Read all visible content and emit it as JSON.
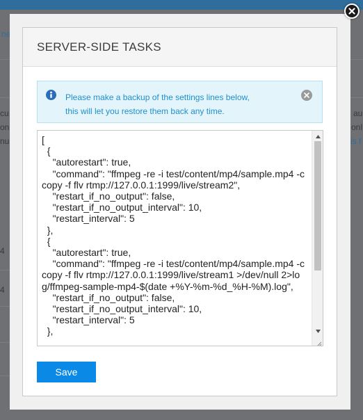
{
  "modal": {
    "title": "SERVER-SIDE TASKS"
  },
  "alert": {
    "line1": "Please make a backup of the settings lines below,",
    "line2": "this will let you restore them back any time."
  },
  "editor": {
    "content": "[\n  {\n    \"autorestart\": true,\n    \"command\": \"ffmpeg -re -i test/content/mp4/sample.mp4 -c copy -f flv rtmp://127.0.0.1:1999/live/stream2\",\n    \"restart_if_no_output\": false,\n    \"restart_if_no_output_interval\": 10,\n    \"restart_interval\": 5\n  },\n  {\n    \"autorestart\": true,\n    \"command\": \"ffmpeg -re -i test/content/mp4/sample.mp4 -c copy -f flv rtmp://127.0.0.1:1999/live/stream1 >/dev/null 2>log/ffmpeg-sample-mp4-$(date +%Y-%m-%d_%H-%M).log\",\n    \"restart_if_no_output\": false,\n    \"restart_if_no_output_interval\": 10,\n    \"restart_interval\": 5\n  },"
  },
  "actions": {
    "save_label": "Save"
  },
  "background": {
    "frag1": "ne",
    "frag2": "cu",
    "frag3": "on",
    "frag4": "nu",
    "frag5": "au",
    "frag6": "onl",
    "frag7": "is f",
    "frag8": "4",
    "frag9": "4"
  },
  "colors": {
    "accent": "#0a8ae6",
    "alert_bg": "#e4f4fb",
    "alert_text": "#1f8fcc"
  }
}
